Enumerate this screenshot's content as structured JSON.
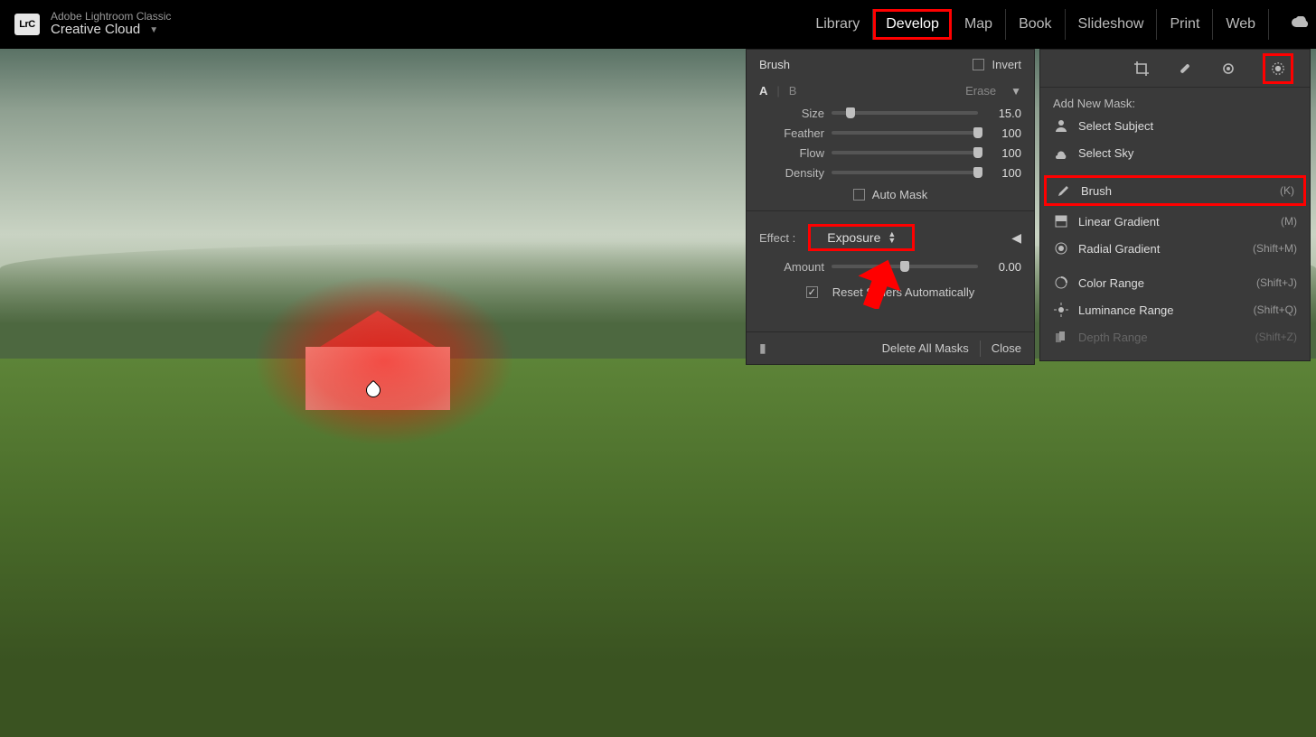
{
  "app": {
    "logo": "LrC",
    "title": "Adobe Lightroom Classic",
    "plan": "Creative Cloud"
  },
  "modules": [
    "Library",
    "Develop",
    "Map",
    "Book",
    "Slideshow",
    "Print",
    "Web"
  ],
  "activeModule": "Develop",
  "brushPanel": {
    "title": "Brush",
    "invert": "Invert",
    "tabs": {
      "a": "A",
      "b": "B",
      "erase": "Erase"
    },
    "sliders": [
      {
        "label": "Size",
        "value": "15.0",
        "pos": 13
      },
      {
        "label": "Feather",
        "value": "100",
        "pos": 100
      },
      {
        "label": "Flow",
        "value": "100",
        "pos": 100
      },
      {
        "label": "Density",
        "value": "100",
        "pos": 100
      }
    ],
    "autoMask": "Auto Mask",
    "effectLabel": "Effect :",
    "effectValue": "Exposure",
    "amount": {
      "label": "Amount",
      "value": "0.00",
      "pos": 50
    },
    "reset": "Reset Sliders Automatically",
    "deleteAll": "Delete All Masks",
    "close": "Close"
  },
  "maskPanel": {
    "addNew": "Add New Mask:",
    "items": [
      {
        "icon": "subject",
        "label": "Select Subject",
        "shortcut": ""
      },
      {
        "icon": "sky",
        "label": "Select Sky",
        "shortcut": ""
      }
    ],
    "items2": [
      {
        "icon": "brush",
        "label": "Brush",
        "shortcut": "(K)",
        "boxed": true
      },
      {
        "icon": "linear",
        "label": "Linear Gradient",
        "shortcut": "(M)"
      },
      {
        "icon": "radial",
        "label": "Radial Gradient",
        "shortcut": "(Shift+M)"
      }
    ],
    "items3": [
      {
        "icon": "color",
        "label": "Color Range",
        "shortcut": "(Shift+J)"
      },
      {
        "icon": "lum",
        "label": "Luminance Range",
        "shortcut": "(Shift+Q)"
      },
      {
        "icon": "depth",
        "label": "Depth Range",
        "shortcut": "(Shift+Z)",
        "disabled": true
      }
    ]
  }
}
